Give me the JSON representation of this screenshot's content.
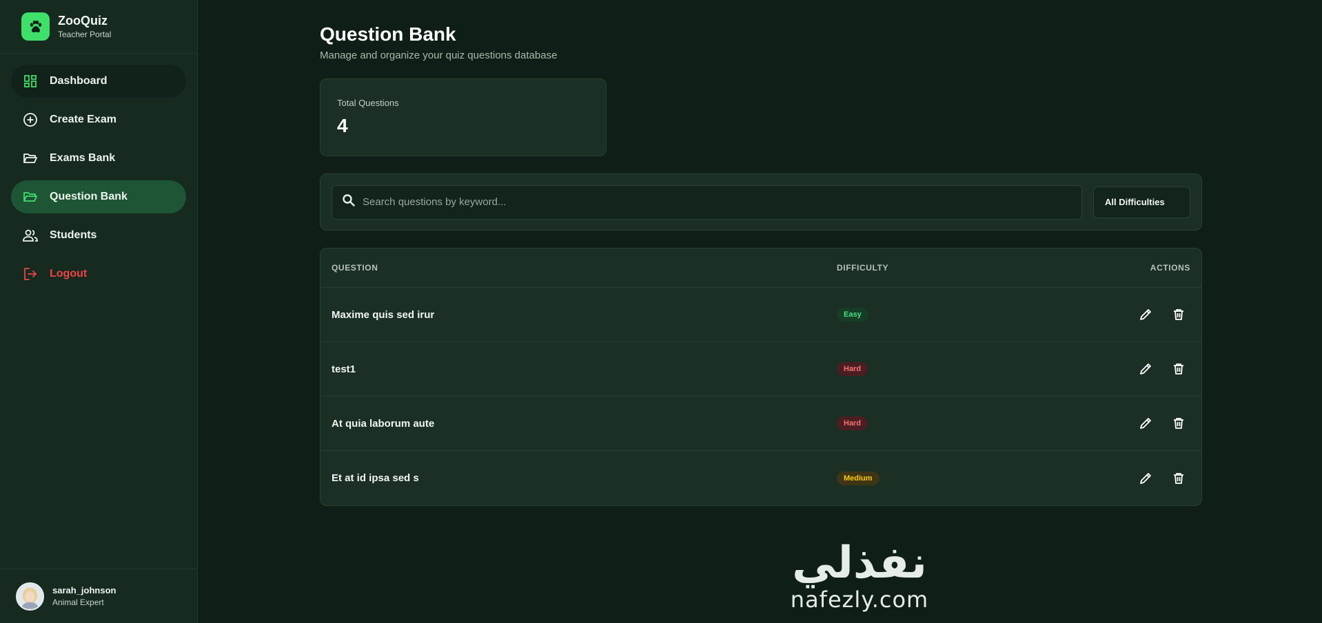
{
  "brand": {
    "title": "ZooQuiz",
    "subtitle": "Teacher Portal"
  },
  "nav": [
    {
      "label": "Dashboard",
      "icon": "dashboard-grid-icon"
    },
    {
      "label": "Create Exam",
      "icon": "plus-circle-icon"
    },
    {
      "label": "Exams Bank",
      "icon": "folder-open-icon"
    },
    {
      "label": "Question Bank",
      "icon": "folder-open-icon",
      "active": true
    },
    {
      "label": "Students",
      "icon": "users-icon"
    },
    {
      "label": "Logout",
      "icon": "logout-icon"
    }
  ],
  "user": {
    "name": "sarah_johnson",
    "role": "Animal Expert"
  },
  "page": {
    "title": "Question Bank",
    "subtitle": "Manage and organize your quiz questions database"
  },
  "stats": {
    "label": "Total Questions",
    "value": "4"
  },
  "filters": {
    "search_placeholder": "Search questions by keyword...",
    "difficulty_selected": "All Difficulties"
  },
  "table": {
    "headers": {
      "question": "QUESTION",
      "difficulty": "DIFFICULTY",
      "actions": "ACTIONS"
    },
    "rows": [
      {
        "question": "Maxime quis sed irur",
        "difficulty": "Easy"
      },
      {
        "question": "test1",
        "difficulty": "Hard"
      },
      {
        "question": "At quia laborum aute",
        "difficulty": "Hard"
      },
      {
        "question": "Et at id ipsa sed s",
        "difficulty": "Medium"
      }
    ]
  },
  "watermark": {
    "arabic": "نفذلي",
    "latin": "nafezly.com"
  },
  "colors": {
    "accent": "#3ee06a",
    "active_nav": "#1e5535",
    "logout": "#ef4444",
    "easy": "#4ade80",
    "hard": "#f87171",
    "medium": "#facc15"
  }
}
